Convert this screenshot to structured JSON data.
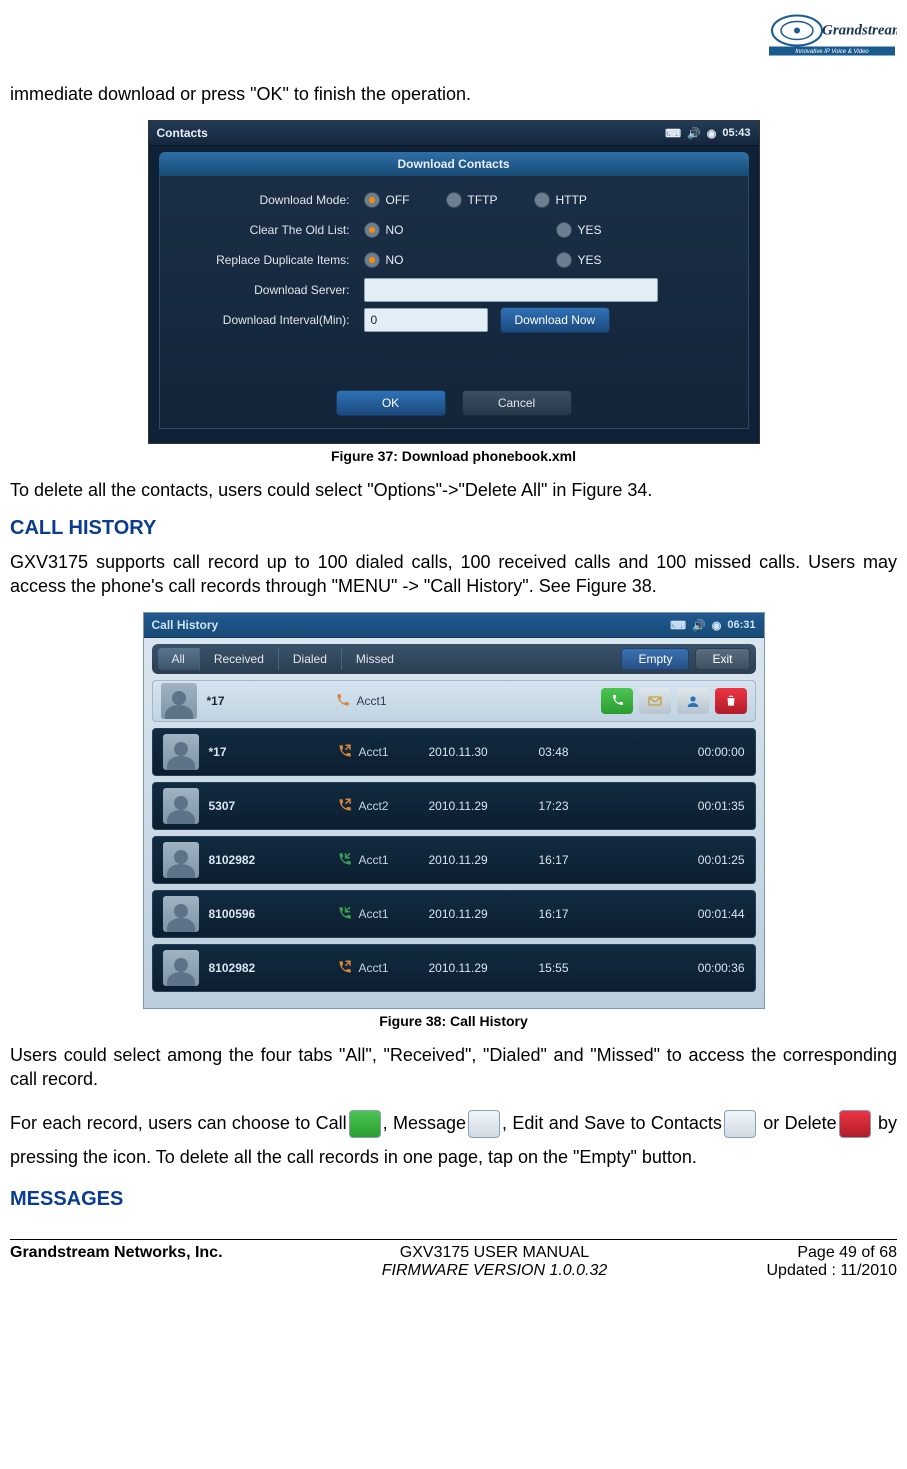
{
  "logo": {
    "brand": "Grandstream",
    "tagline": "Innovative IP Voice & Video"
  },
  "intro_line": "immediate download or press \"OK\" to finish the operation.",
  "figure37_caption": "Figure 37: Download phonebook.xml",
  "para_delete_all": "To delete all the contacts, users could select \"Options\"->\"Delete All\" in Figure 34.",
  "heading_call_history": "CALL HISTORY",
  "para_call_history": "GXV3175 supports call record up to 100 dialed calls, 100 received calls and 100 missed calls. Users may access the phone's call records through \"MENU\" -> \"Call History\". See Figure 38.",
  "figure38_caption": "Figure 38: Call History",
  "para_tabs": "Users could select among the four tabs \"All\", \"Received\", \"Dialed\" and \"Missed\" to access the corresponding call record.",
  "para_actions_1": "For each record, users can choose to Call",
  "para_actions_2": ", Message",
  "para_actions_3": ", Edit and Save to Contacts",
  "para_actions_4": " or Delete",
  "para_actions_5": " by pressing the icon. To delete all the call records in one page, tap on the \"Empty\" button.",
  "heading_messages": "MESSAGES",
  "footer": {
    "company": "Grandstream Networks, Inc.",
    "manual": "GXV3175 USER MANUAL",
    "firmware": "FIRMWARE VERSION 1.0.0.32",
    "page": "Page 49 of 68",
    "updated": "Updated : 11/2010"
  },
  "screenshot1": {
    "title_bar": "Contacts",
    "clock": "05:43",
    "dialog_title": "Download Contacts",
    "labels": {
      "mode": "Download Mode:",
      "clear": "Clear The Old List:",
      "replace": "Replace Duplicate Items:",
      "server": "Download Server:",
      "interval": "Download Interval(Min):"
    },
    "options": {
      "mode": [
        "OFF",
        "TFTP",
        "HTTP"
      ],
      "clear": [
        "NO",
        "YES"
      ],
      "replace": [
        "NO",
        "YES"
      ]
    },
    "selected": {
      "mode": "OFF",
      "clear": "NO",
      "replace": "NO"
    },
    "server_value": "",
    "interval_value": "0",
    "download_now": "Download Now",
    "ok": "OK",
    "cancel": "Cancel"
  },
  "screenshot2": {
    "title_bar": "Call History",
    "clock": "06:31",
    "tabs": [
      "All",
      "Received",
      "Dialed",
      "Missed"
    ],
    "selected_tab": "All",
    "empty_btn": "Empty",
    "exit_btn": "Exit",
    "expanded": {
      "number": "*17",
      "account": "Acct1"
    },
    "rows": [
      {
        "number": "*17",
        "type": "out",
        "account": "Acct1",
        "date": "2010.11.30",
        "time": "03:48",
        "duration": "00:00:00"
      },
      {
        "number": "5307",
        "type": "out",
        "account": "Acct2",
        "date": "2010.11.29",
        "time": "17:23",
        "duration": "00:01:35"
      },
      {
        "number": "8102982",
        "type": "in",
        "account": "Acct1",
        "date": "2010.11.29",
        "time": "16:17",
        "duration": "00:01:25"
      },
      {
        "number": "8100596",
        "type": "in",
        "account": "Acct1",
        "date": "2010.11.29",
        "time": "16:17",
        "duration": "00:01:44"
      },
      {
        "number": "8102982",
        "type": "out",
        "account": "Acct1",
        "date": "2010.11.29",
        "time": "15:55",
        "duration": "00:00:36"
      }
    ]
  }
}
